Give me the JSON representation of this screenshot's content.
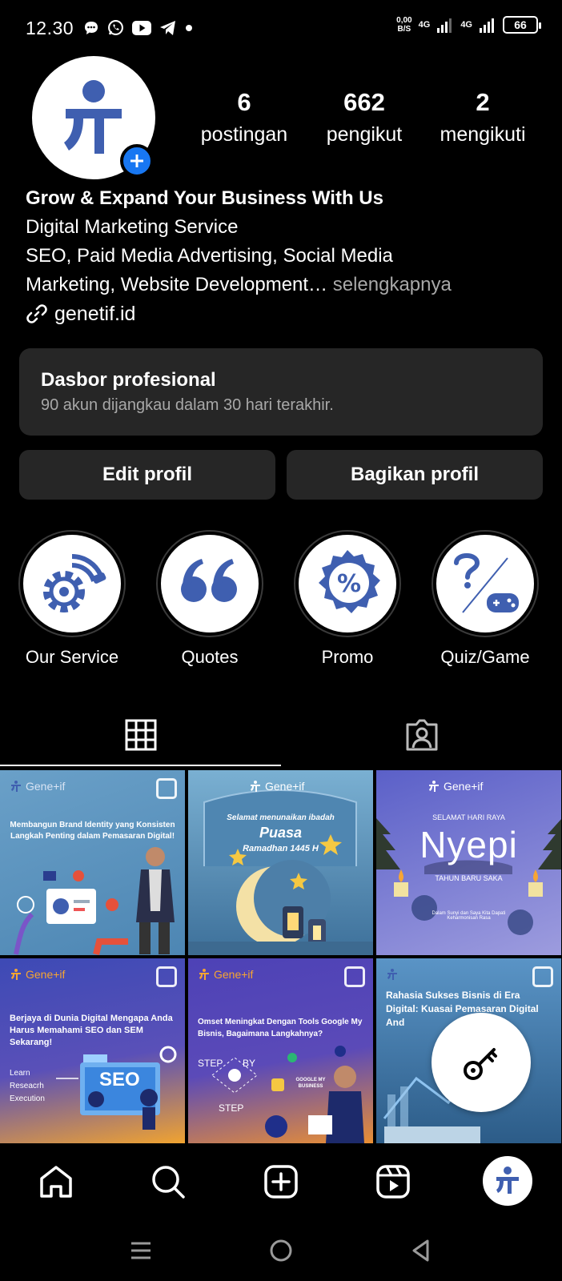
{
  "status_bar": {
    "time": "12.30",
    "net_speed_value": "0,00",
    "net_speed_unit": "B/S",
    "signal_1": "4G",
    "signal_2": "4G",
    "battery": "66"
  },
  "profile": {
    "stats": [
      {
        "value": "6",
        "label": "postingan"
      },
      {
        "value": "662",
        "label": "pengikut"
      },
      {
        "value": "2",
        "label": "mengikuti"
      }
    ],
    "bio": {
      "name": "Grow & Expand Your Business With Us",
      "category": "Digital Marketing Service",
      "line1": "SEO, Paid Media Advertising, Social Media",
      "line2": "Marketing, Website Development…",
      "more": "selengkapnya",
      "link": "genetif.id"
    }
  },
  "dashboard": {
    "title": "Dasbor profesional",
    "subtitle": "90 akun dijangkau dalam 30 hari terakhir."
  },
  "buttons": {
    "edit": "Edit profil",
    "share": "Bagikan profil"
  },
  "highlights": [
    {
      "label": "Our Service",
      "icon": "gear-phone-icon"
    },
    {
      "label": "Quotes",
      "icon": "quote-icon"
    },
    {
      "label": "Promo",
      "icon": "percent-badge-icon"
    },
    {
      "label": "Quiz/Game",
      "icon": "question-gamepad-icon"
    }
  ],
  "posts": [
    {
      "brand": "Gene+if",
      "text": "Membangun Brand Identity yang Konsisten Langkah Penting dalam Pemasaran Digital!",
      "bg": "#5a8fb5"
    },
    {
      "brand": "Gene+if",
      "text": "Selamat menunaikan ibadah",
      "title": "Puasa",
      "subtitle": "Ramadhan 1445 H",
      "bg": "#4a7ea6"
    },
    {
      "brand": "Gene+if",
      "text": "SELAMAT HARI RAYA",
      "title": "Nyepi",
      "subtitle": "TAHUN BARU SAKA",
      "note": "Dalam Sunyi dan Saya Kita Dapati Keharmonisan Rasa",
      "bg": "#6c6fcf"
    },
    {
      "brand": "Gene+if",
      "text": "Berjaya di Dunia Digital Mengapa Anda Harus Memahami SEO dan SEM Sekarang!",
      "steps": [
        "Learn",
        "Reseacrh",
        "Execution"
      ],
      "badge": "SEO",
      "bg": "#4b4fb4"
    },
    {
      "brand": "Gene+if",
      "text": "Omset Meningkat Dengan Tools Google My Bisnis, Bagaimana Langkahnya?",
      "step_a": "STEP",
      "step_b": "BY",
      "step_c": "STEP",
      "badge": "GOOGLE MY BUSINESS",
      "bg": "#5548b8"
    },
    {
      "brand": "",
      "text": "Rahasia Sukses Bisnis di Era Digital: Kuasai Pemasaran Digital And",
      "bg": "#3e7aae"
    }
  ],
  "colors": {
    "accent": "#1877f2",
    "brand_blue": "#3f5fb0",
    "surface": "#262626"
  }
}
